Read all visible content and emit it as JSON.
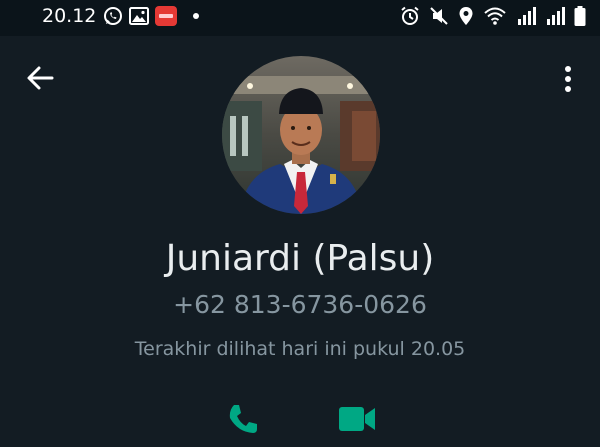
{
  "status_bar": {
    "time": "20.12",
    "left_icons": [
      "whatsapp-icon",
      "gallery-icon",
      "app-notification-icon",
      "dot-icon"
    ],
    "right_icons": [
      "alarm-icon",
      "mute-icon",
      "location-icon",
      "wifi-icon",
      "signal-icon",
      "signal-icon-2",
      "battery-icon"
    ]
  },
  "header": {
    "back_icon": "arrow-left-icon",
    "menu_icon": "more-vertical-icon"
  },
  "contact": {
    "name": "Juniardi (Palsu)",
    "phone": "+62 813-6736-0626",
    "last_seen": "Terakhir dilihat hari ini pukul 20.05"
  },
  "actions": {
    "call_icon": "phone-icon",
    "video_icon": "video-call-icon",
    "accent_color": "#00a884"
  },
  "colors": {
    "background": "#121b22",
    "status_bar": "#0b141a",
    "primary_text": "#e9edef",
    "secondary_text": "#8696a0"
  }
}
